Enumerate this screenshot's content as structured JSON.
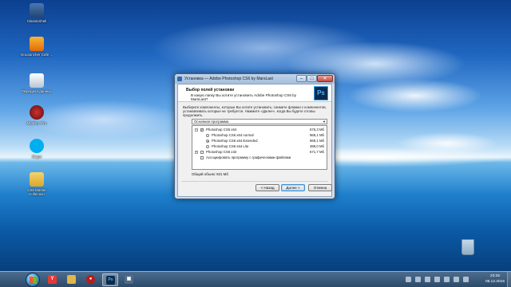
{
  "desktop_icons": [
    {
      "label": "ClassicShell",
      "name": "classicshell"
    },
    {
      "label": "GoLauncher Cafe ...",
      "name": "golauncher"
    },
    {
      "label": "Передача данных",
      "name": "data-transfer"
    },
    {
      "label": "MiniRec Pro",
      "name": "minirec"
    },
    {
      "label": "Skype",
      "name": "skype"
    },
    {
      "label": "CS6 Master Collection",
      "name": "folder"
    }
  ],
  "window": {
    "title": "Установка — Adobe Photoshop CS6 by MarsLast",
    "header_title": "Выбор полей установки",
    "header_subtitle": "В какую папку Вы хотите установить Adobe Photoshop CS6 by MarsLast?",
    "logo_text": "Ps",
    "description": "Выберите компоненты, которые Вы хотите установить; снимите флажки с компонентов, устанавливать которые не требуется. Нажмите «Далее», когда Вы будете готовы продолжить.",
    "select_value": "Основная программа",
    "components": [
      {
        "label": "Photoshop CS6 x64",
        "size": "676,3 Мб",
        "control": "checkbox",
        "checked": true,
        "expand": "−",
        "indent": 0
      },
      {
        "label": "Photoshop CS6 x64 normal",
        "size": "969,1 Мб",
        "control": "radio",
        "checked": false,
        "indent": 1
      },
      {
        "label": "Photoshop CS6 x64 Extended",
        "size": "969,1 Мб",
        "control": "radio",
        "checked": true,
        "indent": 1
      },
      {
        "label": "Photoshop CS6 x64 Lite",
        "size": "386,0 Мб",
        "control": "radio",
        "checked": false,
        "indent": 1
      },
      {
        "label": "Photoshop CS6 x32",
        "size": "671,7 Мб",
        "control": "checkbox",
        "checked": false,
        "expand": "+",
        "indent": 0
      },
      {
        "label": "Ассоциировать программу с графическими файлами",
        "size": "",
        "control": "checkbox",
        "checked": false,
        "indent": 0
      }
    ],
    "total_size": "Общий объем: 921 Мб",
    "buttons": {
      "back": "< Назад",
      "next": "Далее >",
      "cancel": "Отмена"
    },
    "controls": {
      "minimize": "–",
      "maximize": "□",
      "close": "✕"
    }
  },
  "taskbar": {
    "items": [
      {
        "name": "yandex",
        "glyph": "Y",
        "color": "#e53935",
        "active": false
      },
      {
        "name": "explorer",
        "glyph": "",
        "color": "#e2b64a",
        "active": false
      },
      {
        "name": "media",
        "glyph": "●",
        "color": "#b71c1c",
        "active": false
      },
      {
        "name": "photoshop",
        "glyph": "Ps",
        "color": "#0b2b4d",
        "active": true
      },
      {
        "name": "app",
        "glyph": "▣",
        "color": "#4f6b88",
        "active": false
      }
    ],
    "clock_time": "23:25",
    "clock_date": "08.12.2016"
  }
}
